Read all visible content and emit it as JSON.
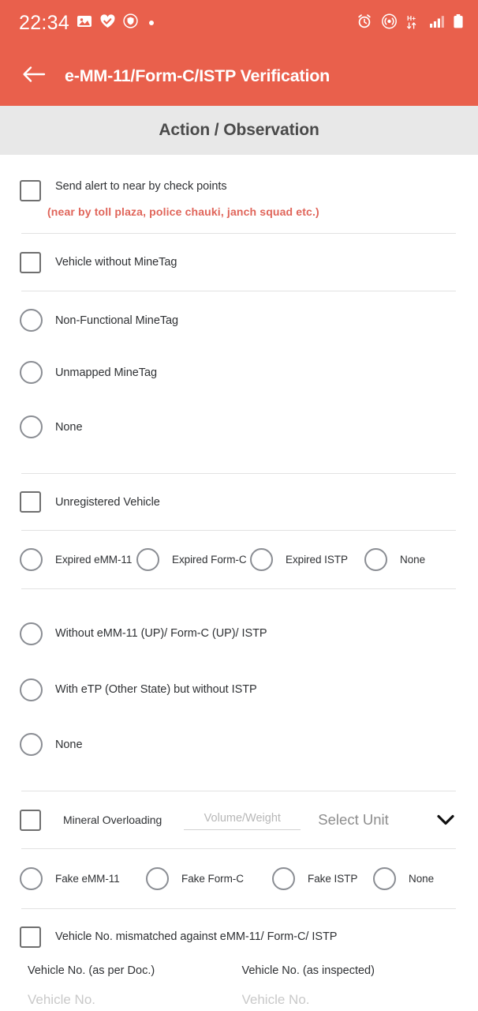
{
  "statusbar": {
    "time": "22:34",
    "left_icons": [
      "image-icon",
      "heart-check-icon",
      "shield-icon",
      "dot-indicator-icon"
    ],
    "right_icons": [
      "alarm-icon",
      "hotspot-icon",
      "hplus-data-icon",
      "signal-bars-icon",
      "battery-icon"
    ],
    "data_label": "H+"
  },
  "appbar": {
    "back_icon": "back-arrow-icon",
    "title": "e-MM-11/Form-C/ISTP Verification"
  },
  "section": {
    "title": "Action / Observation"
  },
  "colors": {
    "header_bg": "#e9604c",
    "section_bg": "#e8e8e8",
    "hint_text": "#e0655a",
    "divider": "#e2e2e2",
    "checkbox_border": "#6f6f6f",
    "radio_border": "#8a8d93",
    "label_text": "#2f3134",
    "placeholder": "#b7b7b7"
  },
  "form": {
    "alert_checkbox": {
      "label": "Send alert to near by check points",
      "hint": "(near by toll plaza, police chauki, janch squad etc.)",
      "checked": false
    },
    "vehicle_without_minetag": {
      "label": "Vehicle without MineTag",
      "checked": false
    },
    "minetag_radios": [
      {
        "label": "Non-Functional MineTag",
        "selected": false
      },
      {
        "label": "Unmapped MineTag",
        "selected": false
      },
      {
        "label": "None",
        "selected": false
      }
    ],
    "unregistered_vehicle": {
      "label": "Unregistered Vehicle",
      "checked": false
    },
    "expired_radios": [
      {
        "label": "Expired eMM-11",
        "selected": false
      },
      {
        "label": "Expired Form-C",
        "selected": false
      },
      {
        "label": "Expired ISTP",
        "selected": false
      },
      {
        "label": "None",
        "selected": false
      }
    ],
    "without_doc_radios": [
      {
        "label": "Without eMM-11 (UP)/ Form-C (UP)/ ISTP",
        "selected": false
      },
      {
        "label": "With eTP (Other State) but without ISTP",
        "selected": false
      },
      {
        "label": "None",
        "selected": false
      }
    ],
    "mineral_overloading": {
      "label": "Mineral Overloading",
      "checked": false,
      "amount_value": "",
      "amount_placeholder": "Volume/Weight",
      "unit_selected": "Select Unit",
      "unit_chevron": "chevron-down-icon"
    },
    "fake_radios": [
      {
        "label": "Fake eMM-11",
        "selected": false
      },
      {
        "label": "Fake Form-C",
        "selected": false
      },
      {
        "label": "Fake ISTP",
        "selected": false
      },
      {
        "label": "None",
        "selected": false
      }
    ],
    "vehicle_mismatch": {
      "label": "Vehicle No. mismatched against eMM-11/ Form-C/ ISTP",
      "checked": false
    },
    "vehicle_no_doc": {
      "label": "Vehicle No. (as per Doc.)",
      "value": "",
      "placeholder": "Vehicle No."
    },
    "vehicle_no_inspected": {
      "label": "Vehicle No. (as inspected)",
      "value": "",
      "placeholder": "Vehicle No."
    }
  }
}
